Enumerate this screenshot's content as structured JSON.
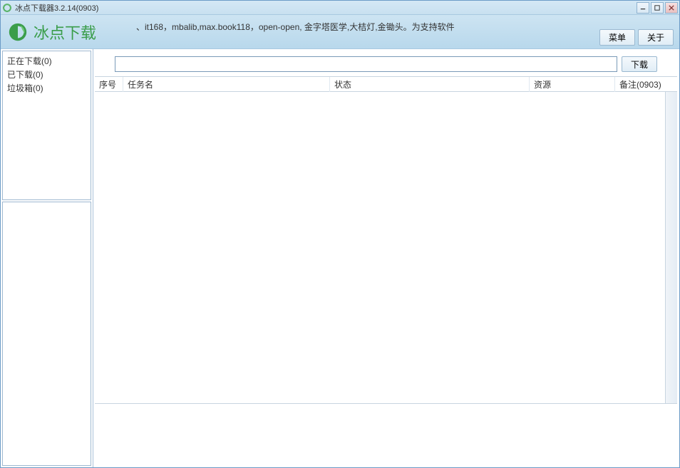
{
  "window": {
    "title": "冰点下载器3.2.14(0903)"
  },
  "header": {
    "app_name": "冰点下载",
    "ticker": "、it168，mbalib,max.book118，open-open, 金字塔医学,大桔灯,金锄头。为支持软件",
    "menu_btn": "菜单",
    "about_btn": "关于"
  },
  "sidebar": {
    "items": [
      {
        "label": "正在下载(0)"
      },
      {
        "label": "已下载(0)"
      },
      {
        "label": "垃圾箱(0)"
      }
    ]
  },
  "urlbar": {
    "input_value": "",
    "download_btn": "下载"
  },
  "table": {
    "columns": {
      "num": "序号",
      "task": "任务名",
      "status": "状态",
      "resource": "资源",
      "remark": "备注(0903)"
    }
  }
}
